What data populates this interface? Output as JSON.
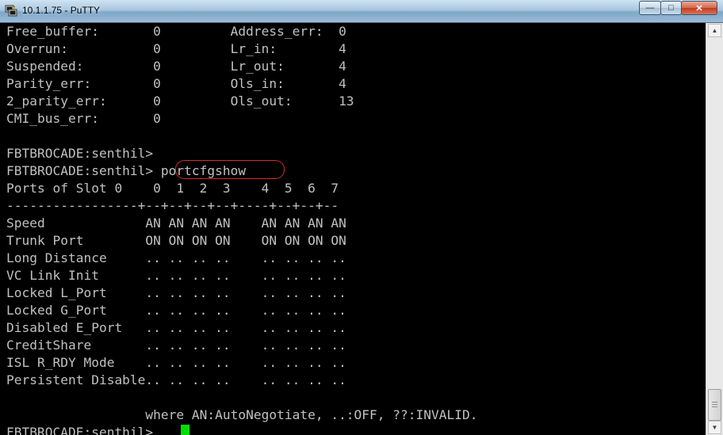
{
  "window": {
    "title": "10.1.1.75 - PuTTY",
    "icon": "putty-icon",
    "buttons": {
      "minimize": "—",
      "maximize": "□",
      "close": "✕"
    }
  },
  "terminal": {
    "lines": [
      "Free_buffer:       0         Address_err:  0",
      "Overrun:           0         Lr_in:        4",
      "Suspended:         0         Lr_out:       4",
      "Parity_err:        0         Ols_in:       4",
      "2_parity_err:      0         Ols_out:      13",
      "CMI_bus_err:       0",
      "",
      "FBTBROCADE:senthil>",
      "FBTBROCADE:senthil> portcfgshow",
      "Ports of Slot 0    0  1  2  3    4  5  6  7",
      "-----------------+--+--+--+--+----+--+--+--",
      "Speed             AN AN AN AN    AN AN AN AN",
      "Trunk Port        ON ON ON ON    ON ON ON ON",
      "Long Distance     .. .. .. ..    .. .. .. ..",
      "VC Link Init      .. .. .. ..    .. .. .. ..",
      "Locked L_Port     .. .. .. ..    .. .. .. ..",
      "Locked G_Port     .. .. .. ..    .. .. .. ..",
      "Disabled E_Port   .. .. .. ..    .. .. .. ..",
      "CreditShare       .. .. .. ..    .. .. .. ..",
      "ISL R_RDY Mode    .. .. .. ..    .. .. .. ..",
      "Persistent Disable.. .. .. ..    .. .. .. ..",
      "",
      "                  where AN:AutoNegotiate, ..:OFF, ??:INVALID.",
      "",
      "FBTBROCADE:senthil> "
    ],
    "colors": {
      "background": "#000000",
      "text": "#c0c0c0",
      "cursor": "#00e000",
      "highlight_circle": "#d62b2b"
    }
  },
  "scrollbar": {
    "up_icon": "scroll-up-arrow-icon",
    "down_icon": "scroll-down-arrow-icon"
  }
}
